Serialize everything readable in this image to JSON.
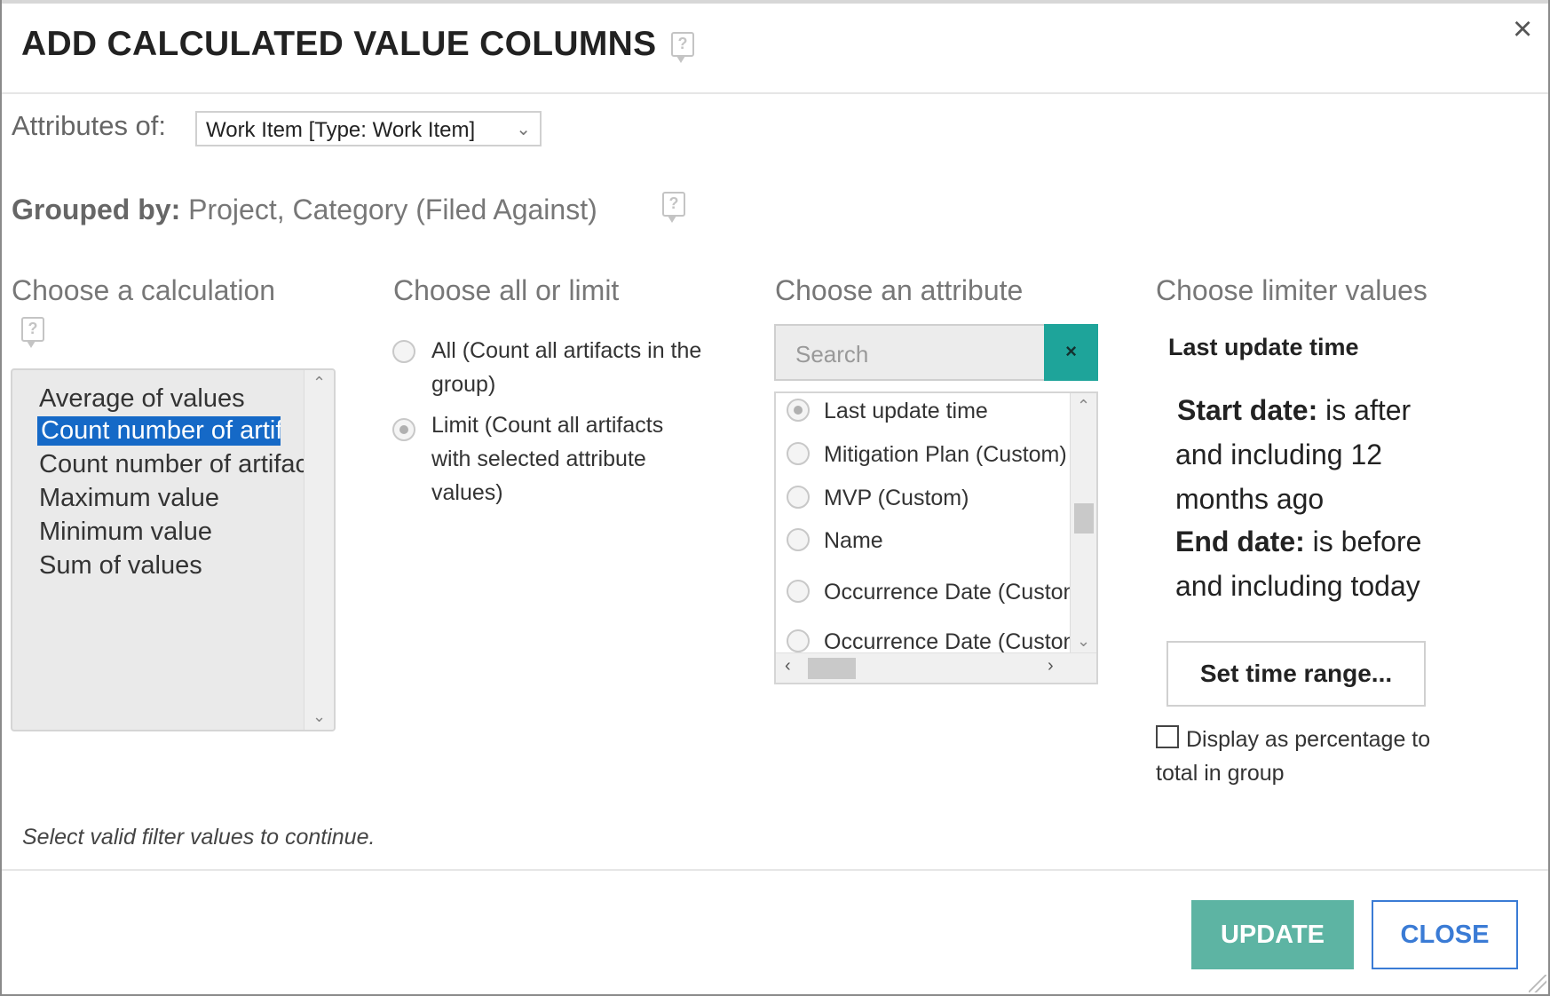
{
  "dialog": {
    "title": "ADD CALCULATED VALUE COLUMNS",
    "close_glyph": "×"
  },
  "attributes_of": {
    "label": "Attributes of:",
    "selected": "Work Item [Type: Work Item]"
  },
  "grouped_by": {
    "label": "Grouped by:",
    "value": "Project, Category (Filed Against)"
  },
  "columns": {
    "calculation": "Choose a calculation",
    "all_or_limit": "Choose all or limit",
    "attribute": "Choose an attribute",
    "limiter": "Choose limiter values"
  },
  "calculations": [
    {
      "label": "Average of values",
      "selected": false
    },
    {
      "label": "Count number of artifacts",
      "selected": true
    },
    {
      "label": "Count number of artifacts",
      "selected": false
    },
    {
      "label": "Maximum value",
      "selected": false
    },
    {
      "label": "Minimum value",
      "selected": false
    },
    {
      "label": "Sum of values",
      "selected": false
    }
  ],
  "scope": {
    "all": {
      "line1": "All (Count all artifacts in the",
      "line2": "group)",
      "checked": false
    },
    "limit": {
      "line1": "Limit (Count all artifacts",
      "line2": "with selected attribute",
      "line3": "values)",
      "checked": true
    }
  },
  "attribute_search": {
    "placeholder": "Search",
    "clear_glyph": "×"
  },
  "attribute_items": [
    {
      "label": "Last update time",
      "checked": true
    },
    {
      "label": "Mitigation Plan (Custom)",
      "checked": false
    },
    {
      "label": "MVP (Custom)",
      "checked": false
    },
    {
      "label": "Name",
      "checked": false
    },
    {
      "label": "Occurrence Date (Custom)",
      "checked": false
    },
    {
      "label": "Occurrence Date (Custom)",
      "checked": false
    }
  ],
  "limiter": {
    "attribute_name": "Last update time",
    "start_label": "Start date:",
    "start_l1": "is after",
    "start_l2": "and including 12",
    "start_l3": "months ago",
    "end_label": "End date:",
    "end_l1": "is before",
    "end_l2": "and including today",
    "set_range_button": "Set time range...",
    "percentage_label": "Display as percentage to total in group",
    "percentage_checked": false
  },
  "footer": {
    "hint": "Select valid filter values to continue.",
    "update_button": "UPDATE",
    "close_button": "CLOSE"
  }
}
